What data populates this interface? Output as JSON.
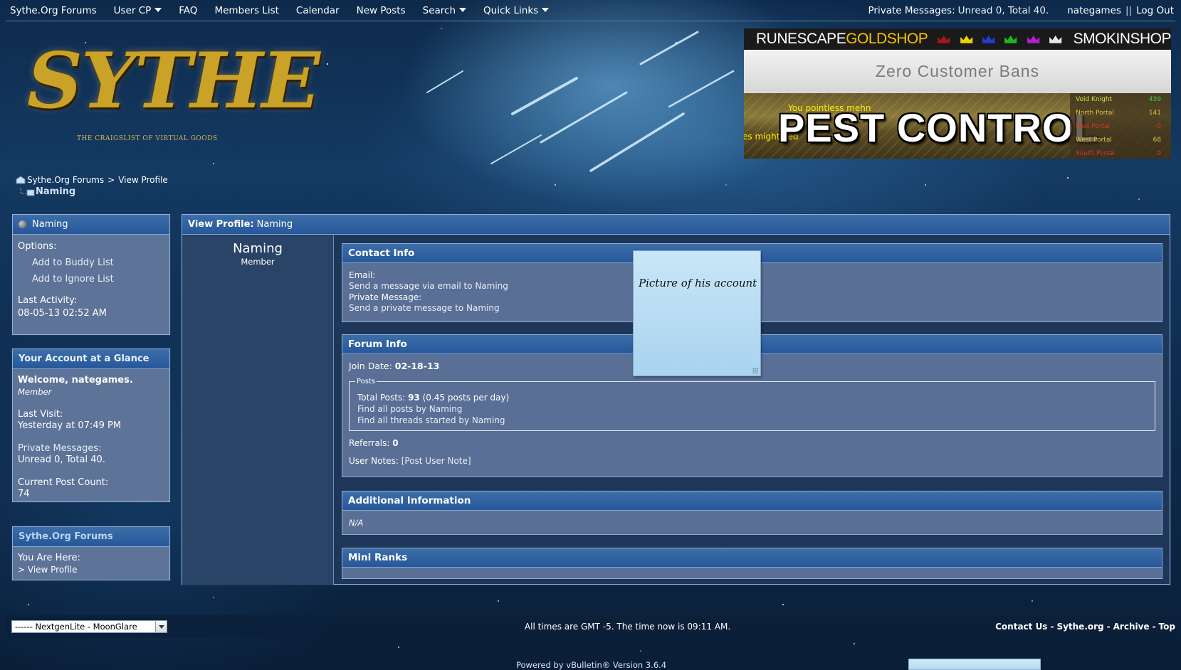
{
  "topnav": {
    "items": [
      {
        "label": "Sythe.Org Forums",
        "dropdown": false
      },
      {
        "label": "User CP",
        "dropdown": true
      },
      {
        "label": "FAQ",
        "dropdown": false
      },
      {
        "label": "Members List",
        "dropdown": false
      },
      {
        "label": "Calendar",
        "dropdown": false
      },
      {
        "label": "New Posts",
        "dropdown": false
      },
      {
        "label": "Search",
        "dropdown": true
      },
      {
        "label": "Quick Links",
        "dropdown": true
      }
    ],
    "pm_label": "Private Messages:",
    "pm_value": "Unread 0, Total 40.",
    "username": "nategames",
    "separator": "||",
    "logout": "Log Out"
  },
  "logo": {
    "brand": "SYTHE",
    "tagline": "THE CRAIGSLIST OF VIRTUAL GOODS"
  },
  "ad": {
    "title_white": "RUNESCAPE",
    "title_gold": "GOLDSHOP",
    "crown_colors": [
      "#a3161a",
      "#f0d400",
      "#1f3fd6",
      "#1fb81f",
      "#b51fd0",
      "#e8e8e8"
    ],
    "title_right": "SMOKINSHOP",
    "tagline": "Zero Customer Bans",
    "headline": "PEST CONTROL",
    "chat_top": "You pointless mehn",
    "chat_bottom": "es might eed",
    "scoreboard": [
      {
        "label": "Void Knight",
        "value": "439"
      },
      {
        "label": "North Portal",
        "value": "141"
      },
      {
        "label": "East Portal",
        "value": "0"
      },
      {
        "label": "West Portal",
        "value": "68"
      },
      {
        "label": "South Portal",
        "value": "0"
      }
    ]
  },
  "breadcrumb": {
    "root": "Sythe.Org Forums",
    "separator": ">",
    "current_page": "View Profile",
    "current": "Naming"
  },
  "sidebar_user": {
    "title": "Naming",
    "options_label": "Options:",
    "options": [
      "Add to Buddy List",
      "Add to Ignore List"
    ],
    "last_activity_label": "Last Activity:",
    "last_activity": "08-05-13 02:52 AM"
  },
  "sidebar_account": {
    "title": "Your Account at a Glance",
    "welcome": "Welcome, nategames.",
    "role": "Member",
    "last_visit_label": "Last Visit:",
    "last_visit": "Yesterday at 07:49 PM",
    "pm_label": "Private Messages:",
    "pm_value": "Unread 0, Total 40.",
    "post_count_label": "Current Post Count:",
    "post_count": "74"
  },
  "sidebar_forums": {
    "title": "Sythe.Org Forums",
    "here_label": "You Are Here:",
    "here_link": "> View Profile"
  },
  "profile": {
    "header_label": "View Profile",
    "header_name": "Naming",
    "name": "Naming",
    "role": "Member",
    "contact": {
      "title": "Contact Info",
      "email_label": "Email:",
      "email_link": "Send a message via email to Naming",
      "pm_label": "Private Message:",
      "pm_link": "Send a private message to Naming"
    },
    "forum": {
      "title": "Forum Info",
      "join_label": "Join Date:",
      "join_value": "02-18-13",
      "posts_legend": "Posts",
      "total_label": "Total Posts:",
      "total_value": "93",
      "per_day": "(0.45 posts per day)",
      "find_posts": "Find all posts by Naming",
      "find_threads": "Find all threads started by Naming",
      "referrals_label": "Referrals:",
      "referrals_value": "0",
      "notes_label": "User Notes:",
      "notes_link": "[Post User Note]"
    },
    "additional": {
      "title": "Additional Information",
      "value": "N/A"
    },
    "mini_ranks": {
      "title": "Mini Ranks"
    }
  },
  "sticky_note": {
    "text": "Picture of his account"
  },
  "footer": {
    "style_selected": "------ NextgenLite - MoonGlare",
    "time_text": "All times are GMT -5. The time now is 09:11 AM.",
    "links": [
      "Contact Us",
      "Sythe.org",
      "Archive",
      "Top"
    ],
    "link_separator": "-",
    "powered": "Powered by vBulletin® Version 3.6.4"
  }
}
